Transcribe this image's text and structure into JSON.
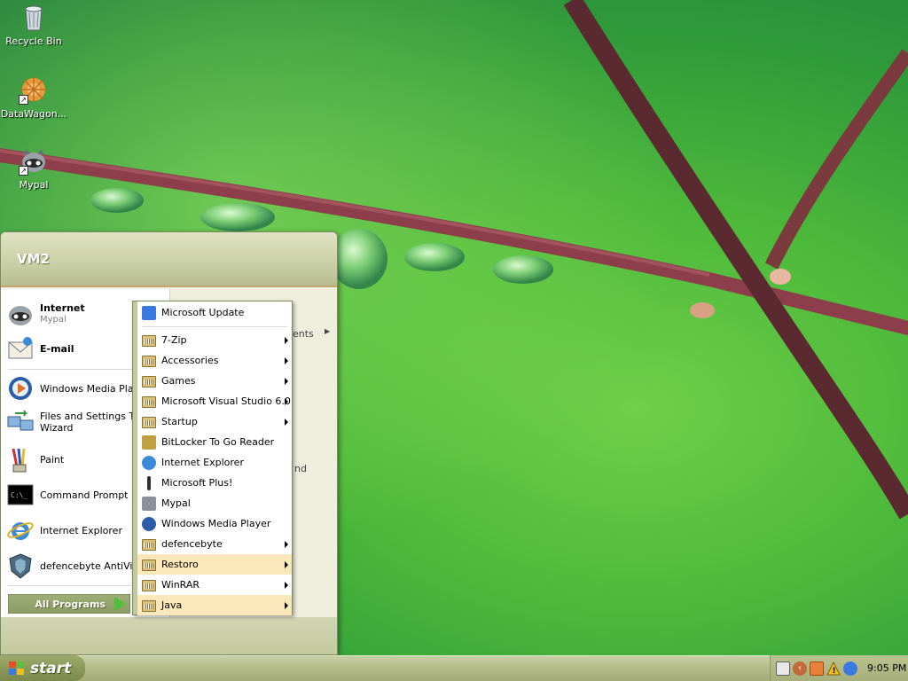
{
  "desktop": {
    "icons": [
      {
        "label": "Recycle Bin",
        "icon": "recycle-bin-icon"
      },
      {
        "label": "DataWagon...",
        "icon": "datawagon-icon"
      },
      {
        "label": "Mypal",
        "icon": "mypal-icon"
      }
    ]
  },
  "start_menu": {
    "user": "VM2",
    "pinned": [
      {
        "title": "Internet",
        "subtitle": "Mypal"
      },
      {
        "title": "E-mail",
        "subtitle": ""
      }
    ],
    "recent": [
      {
        "label": "Windows Media Player"
      },
      {
        "label": "Files and Settings Transfer",
        "label2": "Wizard"
      },
      {
        "label": "Paint"
      },
      {
        "label": "Command Prompt"
      },
      {
        "label": "Internet Explorer"
      },
      {
        "label": "defencebyte AntiVirus"
      }
    ],
    "all_programs": "All Programs",
    "right_fragments": {
      "recent_docs": "ents",
      "search": "nd"
    }
  },
  "programs_menu": {
    "items": [
      {
        "label": "Microsoft Update",
        "icon": "windows-update-icon",
        "arrow": false,
        "highlight": false
      },
      {
        "label": "7-Zip",
        "icon": "folder-icon",
        "arrow": true,
        "highlight": false
      },
      {
        "label": "Accessories",
        "icon": "folder-icon",
        "arrow": true,
        "highlight": false
      },
      {
        "label": "Games",
        "icon": "folder-icon",
        "arrow": true,
        "highlight": false
      },
      {
        "label": "Microsoft Visual Studio 6.0",
        "icon": "folder-icon",
        "arrow": true,
        "highlight": false
      },
      {
        "label": "Startup",
        "icon": "folder-icon",
        "arrow": true,
        "highlight": false
      },
      {
        "label": "BitLocker To Go Reader",
        "icon": "bitlocker-icon",
        "arrow": false,
        "highlight": false
      },
      {
        "label": "Internet Explorer",
        "icon": "internet-explorer-icon",
        "arrow": false,
        "highlight": false
      },
      {
        "label": "Microsoft Plus!",
        "icon": "microsoft-plus-icon",
        "arrow": false,
        "highlight": false
      },
      {
        "label": "Mypal",
        "icon": "mypal-icon",
        "arrow": false,
        "highlight": false
      },
      {
        "label": "Windows Media Player",
        "icon": "media-player-icon",
        "arrow": false,
        "highlight": false
      },
      {
        "label": "defencebyte",
        "icon": "folder-icon",
        "arrow": true,
        "highlight": false
      },
      {
        "label": "Restoro",
        "icon": "folder-icon",
        "arrow": true,
        "highlight": true
      },
      {
        "label": "WinRAR",
        "icon": "folder-icon",
        "arrow": true,
        "highlight": false
      },
      {
        "label": "Java",
        "icon": "folder-icon",
        "arrow": true,
        "highlight": true
      }
    ]
  },
  "taskbar": {
    "start_label": "start",
    "clock": "9:05 PM",
    "tray_icons": [
      "keyboard-icon",
      "collapse-arrow-icon",
      "restoro-tray-icon",
      "warning-icon",
      "network-globe-icon"
    ]
  },
  "colors": {
    "highlight": "#fae8bb",
    "start_green": "#7b8a4a",
    "taskbar": "#b3bb88"
  }
}
